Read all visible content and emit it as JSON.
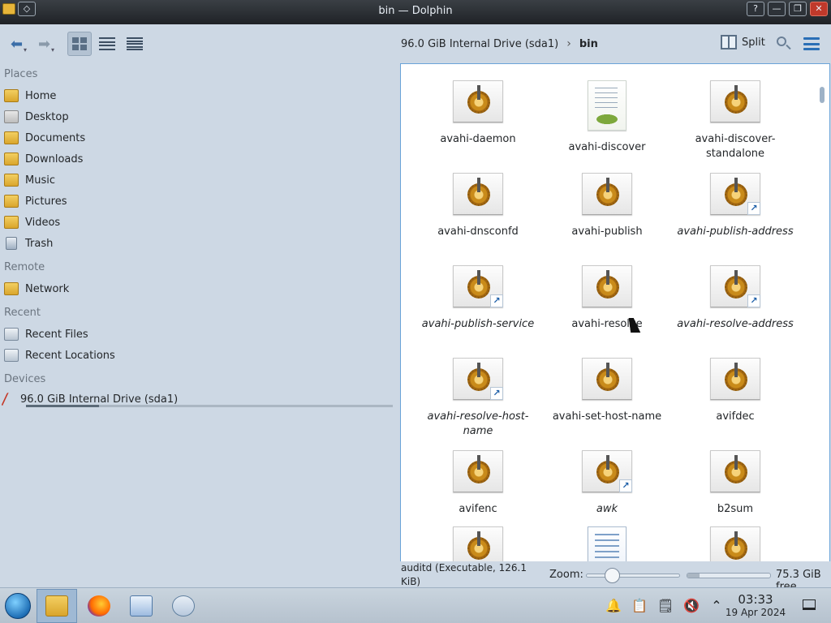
{
  "window": {
    "title": "bin — Dolphin",
    "pin_glyph": "◇",
    "controls": {
      "help": "?",
      "minimize": "—",
      "maximize": "❐",
      "close": "✕"
    }
  },
  "toolbar": {
    "back_glyph": "⬅",
    "forward_glyph": "➡",
    "view_modes": [
      "icons",
      "compact",
      "details"
    ],
    "active_view": "icons",
    "breadcrumb": [
      "96.0 GiB Internal Drive (sda1)",
      "bin"
    ],
    "breadcrumb_sep": "›",
    "split_label": "Split"
  },
  "places": {
    "sections": {
      "places": "Places",
      "remote": "Remote",
      "recent": "Recent",
      "devices": "Devices"
    },
    "items": [
      {
        "label": "Home",
        "icon": "home-folder-icon"
      },
      {
        "label": "Desktop",
        "icon": "desktop-folder-icon"
      },
      {
        "label": "Documents",
        "icon": "documents-folder-icon"
      },
      {
        "label": "Downloads",
        "icon": "downloads-folder-icon"
      },
      {
        "label": "Music",
        "icon": "music-folder-icon"
      },
      {
        "label": "Pictures",
        "icon": "pictures-folder-icon"
      },
      {
        "label": "Videos",
        "icon": "videos-folder-icon"
      },
      {
        "label": "Trash",
        "icon": "trash-icon"
      }
    ],
    "remote_items": [
      {
        "label": "Network",
        "icon": "network-folder-icon"
      }
    ],
    "recent_items": [
      {
        "label": "Recent Files",
        "icon": "recent-files-icon"
      },
      {
        "label": "Recent Locations",
        "icon": "recent-locations-icon"
      }
    ],
    "devices": [
      {
        "label": "96.0 GiB Internal Drive (sda1)",
        "icon": "drive-icon",
        "used_fraction": 0.2
      }
    ]
  },
  "files": [
    {
      "name": "avahi-daemon",
      "type": "executable",
      "link": false
    },
    {
      "name": "avahi-discover",
      "type": "python-script",
      "link": false
    },
    {
      "name": "avahi-discover-standalone",
      "type": "executable",
      "link": false
    },
    {
      "name": "avahi-dnsconfd",
      "type": "executable",
      "link": false
    },
    {
      "name": "avahi-publish",
      "type": "executable",
      "link": false
    },
    {
      "name": "avahi-publish-address",
      "type": "executable",
      "link": true
    },
    {
      "name": "avahi-publish-service",
      "type": "executable",
      "link": true
    },
    {
      "name": "avahi-resolve",
      "type": "executable",
      "link": false
    },
    {
      "name": "avahi-resolve-address",
      "type": "executable",
      "link": true
    },
    {
      "name": "avahi-resolve-host-name",
      "type": "executable",
      "link": true
    },
    {
      "name": "avahi-set-host-name",
      "type": "executable",
      "link": false
    },
    {
      "name": "avifdec",
      "type": "executable",
      "link": false
    },
    {
      "name": "avifenc",
      "type": "executable",
      "link": false
    },
    {
      "name": "awk",
      "type": "executable",
      "link": true
    },
    {
      "name": "b2sum",
      "type": "executable",
      "link": false
    },
    {
      "name": "",
      "type": "executable",
      "link": false
    },
    {
      "name": "",
      "type": "text-document",
      "link": false
    },
    {
      "name": "",
      "type": "executable",
      "link": false
    }
  ],
  "status": {
    "info": "auditd (Executable, 126.1 KiB)",
    "zoom_label": "Zoom:",
    "zoom_level": 0.25,
    "free_space": "75.3 GiB free",
    "used_fraction": 0.15
  },
  "taskbar": {
    "tasks": [
      "start-menu",
      "file-manager",
      "firefox",
      "system-monitor",
      "search"
    ],
    "tray": {
      "notifications": "🔔",
      "clipboard": "📋",
      "battery": "🗒",
      "mute": "🔇",
      "expand": "⌃"
    },
    "time": "03:33",
    "date": "19 Apr 2024"
  }
}
